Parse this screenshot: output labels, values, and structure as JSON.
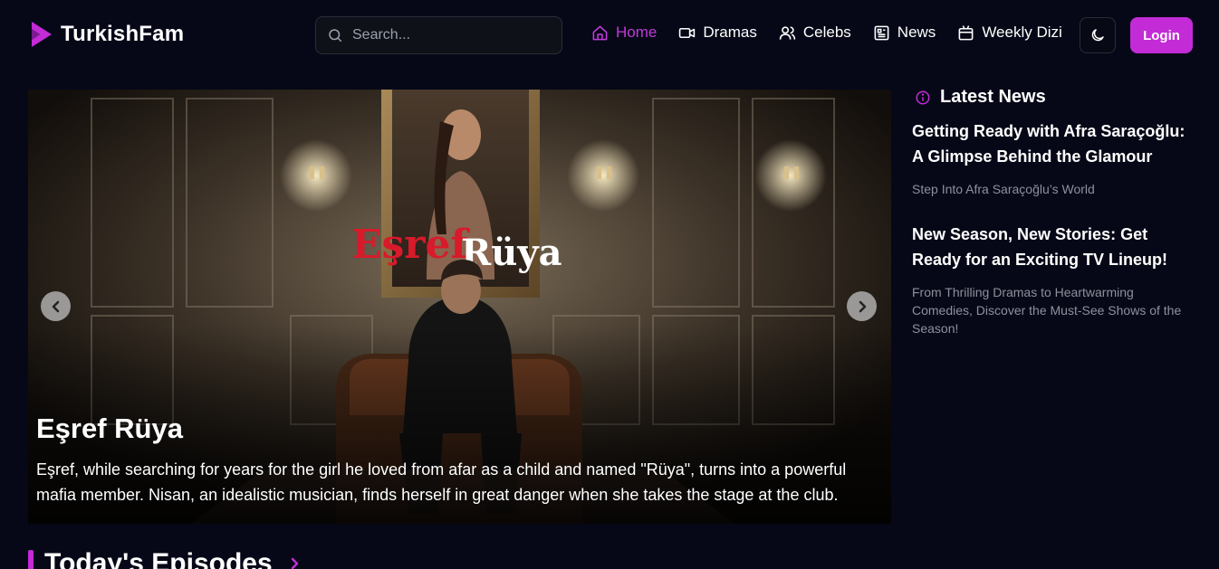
{
  "brand": {
    "name": "TurkishFam",
    "accent": "#c32bd6"
  },
  "search": {
    "placeholder": "Search...",
    "icon": "search-icon"
  },
  "nav": {
    "home": "Home",
    "dramas": "Dramas",
    "celebs": "Celebs",
    "news": "News",
    "weekly": "Weekly Dizi"
  },
  "header": {
    "theme_icon": "moon-icon",
    "login_label": "Login"
  },
  "hero": {
    "poster_title_part1": "Eşref",
    "poster_title_part2": "Rüya",
    "title": "Eşref Rüya",
    "description": "Eşref, while searching for years for the girl he loved from afar as a child and named \"Rüya\", turns into a powerful mafia member. Nisan, an idealistic musician, finds herself in great danger when she takes the stage at the club."
  },
  "latest_news": {
    "heading": "Latest News",
    "items": [
      {
        "title": "Getting Ready with Afra Saraçoğlu: A Glimpse Behind the Glamour",
        "subtitle": "Step Into Afra Saraçoğlu’s World"
      },
      {
        "title": "New Season, New Stories: Get Ready for an Exciting TV Lineup!",
        "subtitle": "From Thrilling Dramas to Heartwarming Comedies, Discover the Must-See Shows of the Season!"
      }
    ]
  },
  "section": {
    "title": "Today's Episodes"
  }
}
